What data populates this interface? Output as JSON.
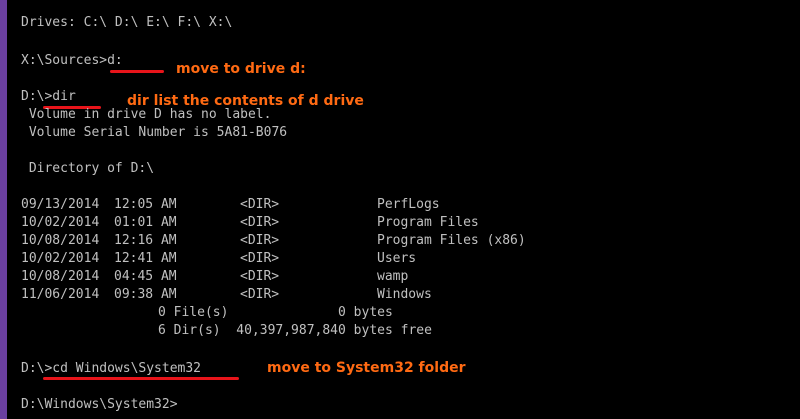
{
  "console": {
    "drives": "Drives: C:\\ D:\\ E:\\ F:\\ X:\\",
    "cmd1": "X:\\Sources>d:",
    "cmd2": "D:\\>dir",
    "volume_label": " Volume in drive D has no label.",
    "volume_serial": " Volume Serial Number is 5A81-B076",
    "directory_of": " Directory of D:\\",
    "entries": [
      {
        "date": "09/13/2014",
        "time": "12:05 AM",
        "type": "<DIR>",
        "name": "PerfLogs"
      },
      {
        "date": "10/02/2014",
        "time": "01:01 AM",
        "type": "<DIR>",
        "name": "Program Files"
      },
      {
        "date": "10/08/2014",
        "time": "12:16 AM",
        "type": "<DIR>",
        "name": "Program Files (x86)"
      },
      {
        "date": "10/02/2014",
        "time": "12:41 AM",
        "type": "<DIR>",
        "name": "Users"
      },
      {
        "date": "10/08/2014",
        "time": "04:45 AM",
        "type": "<DIR>",
        "name": "wamp"
      },
      {
        "date": "11/06/2014",
        "time": "09:38 AM",
        "type": "<DIR>",
        "name": "Windows"
      }
    ],
    "summary_files": "0 File(s)              0 bytes",
    "summary_dirs": "6 Dir(s)  40,397,987,840 bytes free",
    "cmd3": "D:\\>cd Windows\\System32",
    "prompt": "D:\\Windows\\System32>"
  },
  "annotations": {
    "note1": "move to drive d:",
    "note2": "dir list the contents of d drive",
    "note3": "move to System32 folder",
    "color": "#ff6a13",
    "underline_color": "#e8141a"
  }
}
